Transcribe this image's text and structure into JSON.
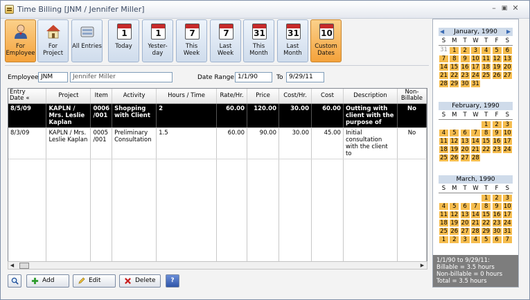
{
  "window": {
    "title": "Time Billing [JNM / Jennifer Miller]"
  },
  "toolbar": {
    "buttons": [
      {
        "label": "For Employee",
        "icon": "employee-icon",
        "active": true
      },
      {
        "label": "For Project",
        "icon": "house-icon",
        "active": false
      },
      {
        "label": "All Entries",
        "icon": "all-entries-icon",
        "active": false
      },
      {
        "label": "Today",
        "icon": "calendar-icon",
        "day": "1",
        "active": false
      },
      {
        "label": "Yester-day",
        "icon": "calendar-icon",
        "day": "1",
        "active": false
      },
      {
        "label": "This Week",
        "icon": "calendar-icon",
        "day": "7",
        "active": false
      },
      {
        "label": "Last Week",
        "icon": "calendar-icon",
        "day": "7",
        "active": false
      },
      {
        "label": "This Month",
        "icon": "calendar-icon",
        "day": "31",
        "active": false
      },
      {
        "label": "Last Month",
        "icon": "calendar-icon",
        "day": "31",
        "active": false
      },
      {
        "label": "Custom Dates",
        "icon": "calendar-icon",
        "day": "10",
        "active": true
      }
    ]
  },
  "filter": {
    "employee_label": "Employee",
    "employee_code": "JNM",
    "employee_name": "Jennifer Miller",
    "range_label": "Date Range",
    "range_from": "1/1/90",
    "to_label": "To",
    "range_to": "9/29/11"
  },
  "grid": {
    "columns": [
      "Entry Date",
      "Project",
      "Item",
      "Activity",
      "Hours / Time",
      "Rate/Hr.",
      "Price",
      "Cost/Hr.",
      "Cost",
      "Description",
      "Non-Billable"
    ],
    "sort_indicator": "«",
    "rows": [
      {
        "date": "8/5/09",
        "project": "KAPLN / Mrs. Leslie Kaplan",
        "item": "0006 /001",
        "activity": "Shopping with Client",
        "hours": "2",
        "rate": "60.00",
        "price": "120.00",
        "costhr": "30.00",
        "cost": "60.00",
        "desc": "Outting with client with the purpose of",
        "nonbill": "No",
        "selected": true
      },
      {
        "date": "8/3/09",
        "project": "KAPLN / Mrs. Leslie Kaplan",
        "item": "0005 /001",
        "activity": "Preliminary Consultation",
        "hours": "1.5",
        "rate": "60.00",
        "price": "90.00",
        "costhr": "30.00",
        "cost": "45.00",
        "desc": "Initial consultation with the client to",
        "nonbill": "No",
        "selected": false
      }
    ]
  },
  "bottom": {
    "add": "Add",
    "edit": "Edit",
    "delete": "Delete",
    "help": "?"
  },
  "calendar": {
    "dow": [
      "S",
      "M",
      "T",
      "W",
      "T",
      "F",
      "S"
    ],
    "months": [
      {
        "title": "January, 1990",
        "weeks": [
          [
            "31",
            "1",
            "2",
            "3",
            "4",
            "5",
            "6"
          ],
          [
            "7",
            "8",
            "9",
            "10",
            "11",
            "12",
            "13"
          ],
          [
            "14",
            "15",
            "16",
            "17",
            "18",
            "19",
            "20"
          ],
          [
            "21",
            "22",
            "23",
            "24",
            "25",
            "26",
            "27"
          ],
          [
            "28",
            "29",
            "30",
            "31",
            "",
            "",
            ""
          ]
        ],
        "grey": [
          "0-0"
        ]
      },
      {
        "title": "February, 1990",
        "weeks": [
          [
            "",
            "",
            "",
            "",
            "1",
            "2",
            "3"
          ],
          [
            "4",
            "5",
            "6",
            "7",
            "8",
            "9",
            "10"
          ],
          [
            "11",
            "12",
            "13",
            "14",
            "15",
            "16",
            "17"
          ],
          [
            "18",
            "19",
            "20",
            "21",
            "22",
            "23",
            "24"
          ],
          [
            "25",
            "26",
            "27",
            "28",
            "",
            "",
            ""
          ]
        ],
        "grey": []
      },
      {
        "title": "March, 1990",
        "weeks": [
          [
            "",
            "",
            "",
            "",
            "1",
            "2",
            "3"
          ],
          [
            "4",
            "5",
            "6",
            "7",
            "8",
            "9",
            "10"
          ],
          [
            "11",
            "12",
            "13",
            "14",
            "15",
            "16",
            "17"
          ],
          [
            "18",
            "19",
            "20",
            "21",
            "22",
            "23",
            "24"
          ],
          [
            "25",
            "26",
            "27",
            "28",
            "29",
            "30",
            "31"
          ],
          [
            "1",
            "2",
            "3",
            "4",
            "5",
            "6",
            "7"
          ]
        ],
        "grey": []
      }
    ],
    "summary": [
      "1/1/90 to 9/29/11:",
      "Billable = 3.5 hours",
      "Non-billable = 0 hours",
      "Total = 3.5 hours"
    ]
  }
}
